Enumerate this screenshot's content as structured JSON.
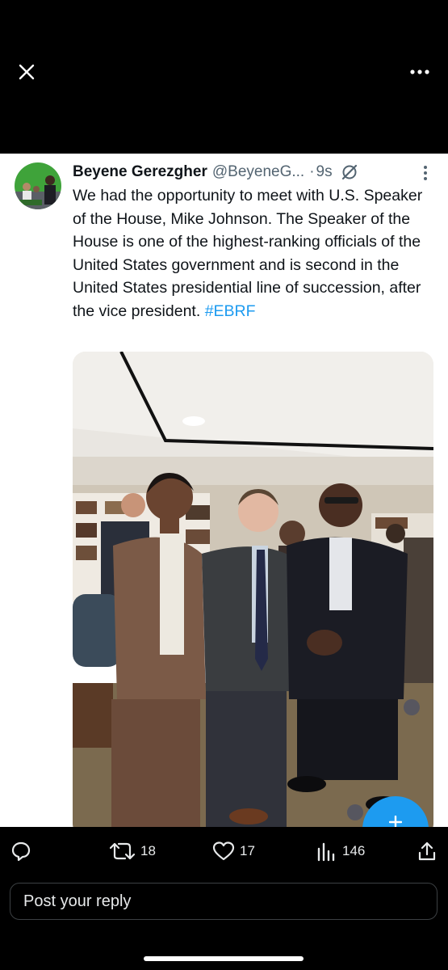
{
  "post": {
    "author_name": "Beyene Gerezgher",
    "author_handle": "@BeyeneG...",
    "separator": "·",
    "time": "9s",
    "text": "We had the opportunity to meet with U.S. Speaker of the House, Mike Johnson. The Speaker of the House is one of the highest-ranking officials of the United States government and is second in the United States presidential line of succession, after the vice president. ",
    "hashtag": "#EBRF"
  },
  "actions": {
    "reply_icon": "reply-icon",
    "repost_count": "18",
    "like_count": "17",
    "view_count": "146",
    "share_icon": "share-icon"
  },
  "reply": {
    "placeholder": "Post your reply"
  },
  "colors": {
    "accent": "#1d9bf0",
    "background": "#000000",
    "card": "#ffffff",
    "text_primary": "#0f1419",
    "text_secondary": "#536471"
  }
}
